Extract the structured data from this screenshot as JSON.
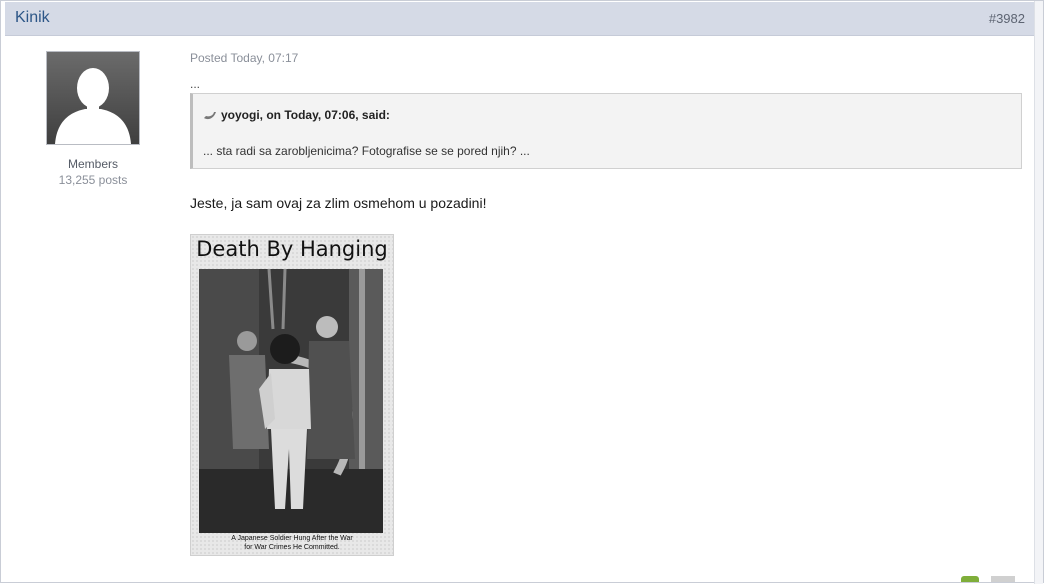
{
  "post": {
    "author": "Kinik",
    "number": "#3982",
    "posted": "Posted Today, 07:17",
    "ellipsis": "...",
    "reply": "Jeste, ja sam ovaj za zlim osmehom u pozadini!"
  },
  "author_info": {
    "group": "Members",
    "post_count": "13,255 posts"
  },
  "quote": {
    "citation": "yoyogi, on Today, 07:06, said:",
    "text": "... sta radi sa zarobljenicima? Fotografise se se pored njih? ..."
  },
  "image": {
    "title": "Death By Hanging",
    "caption_line1": "A Japanese Soldier Hung After the War",
    "caption_line2": "for War Crimes He Committed."
  },
  "icons": {
    "avatar": "default-avatar-silhouette-icon",
    "quote": "quote-arrow-icon"
  },
  "colors": {
    "header_bg": "#d5dae6",
    "author_link": "#2c5687",
    "muted_text": "#8a8f99"
  }
}
